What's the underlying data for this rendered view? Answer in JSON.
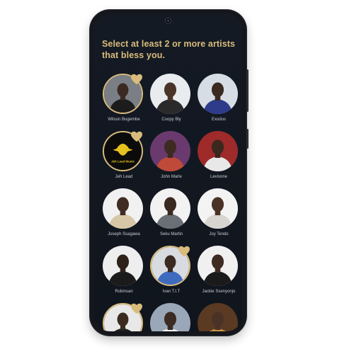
{
  "header": {
    "title": "Select at least 2 or more artists that bless you."
  },
  "colors": {
    "accent": "#d9bc7b",
    "background": "#141a24",
    "text_secondary": "#c9ccd3"
  },
  "artists": [
    {
      "name": "Wilson Bugembe",
      "selected": true,
      "icon": "heart-icon",
      "bg": "#7a7f86",
      "skin": "#3b2a22",
      "shirt": "#1c1c1c"
    },
    {
      "name": "Coopy Bly",
      "selected": false,
      "bg": "#e9ecef",
      "skin": "#4a3428",
      "shirt": "#2a2a2a"
    },
    {
      "name": "Exodus",
      "selected": false,
      "bg": "#d7dde4",
      "skin": "#3a2a20",
      "shirt": "#2d3b8a"
    },
    {
      "name": "Jeh Lead",
      "selected": true,
      "icon": "heart-icon",
      "logo_text": "Jeh Lead Music",
      "bg": "#0b0b0b"
    },
    {
      "name": "John Marle",
      "selected": false,
      "bg": "#6a3a6e",
      "skin": "#3d2b22",
      "shirt": "#c04a3a"
    },
    {
      "name": "Levixone",
      "selected": false,
      "bg": "#9e2a2a",
      "skin": "#3a281f",
      "shirt": "#e8e8e8"
    },
    {
      "name": "Joseph Ssagawa",
      "selected": false,
      "bg": "#f1f1f1",
      "skin": "#3f2c22",
      "shirt": "#d8c7a6"
    },
    {
      "name": "Seku Martin",
      "selected": false,
      "bg": "#f2f2f2",
      "skin": "#3a2920",
      "shirt": "#6a6f75"
    },
    {
      "name": "Joy Tendo",
      "selected": false,
      "bg": "#f3f3f3",
      "skin": "#4a3226",
      "shirt": "#d8d4cf"
    },
    {
      "name": "Robinsan",
      "selected": false,
      "bg": "#eeeeee",
      "skin": "#2e211a",
      "shirt": "#1b1b1b"
    },
    {
      "name": "Ivan T.I.T",
      "selected": true,
      "icon": "heart-icon",
      "bg": "#d8dbe0",
      "skin": "#3b2a21",
      "shirt": "#3f6bbf"
    },
    {
      "name": "Jackie Ssenyonjo",
      "selected": false,
      "bg": "#f0f0f0",
      "skin": "#3e2b21",
      "shirt": "#1a1a1a"
    },
    {
      "name": "",
      "selected": true,
      "icon": "heart-icon",
      "bg": "#e8e8e8",
      "skin": "#3a2a20",
      "shirt": "#202020"
    },
    {
      "name": "",
      "selected": false,
      "bg": "#9aa7b8",
      "skin": "#3c2b22",
      "shirt": "#ffffff"
    },
    {
      "name": "",
      "selected": false,
      "bg": "#5a3a22",
      "skin": "#4a3326",
      "shirt": "#c7953e"
    }
  ]
}
